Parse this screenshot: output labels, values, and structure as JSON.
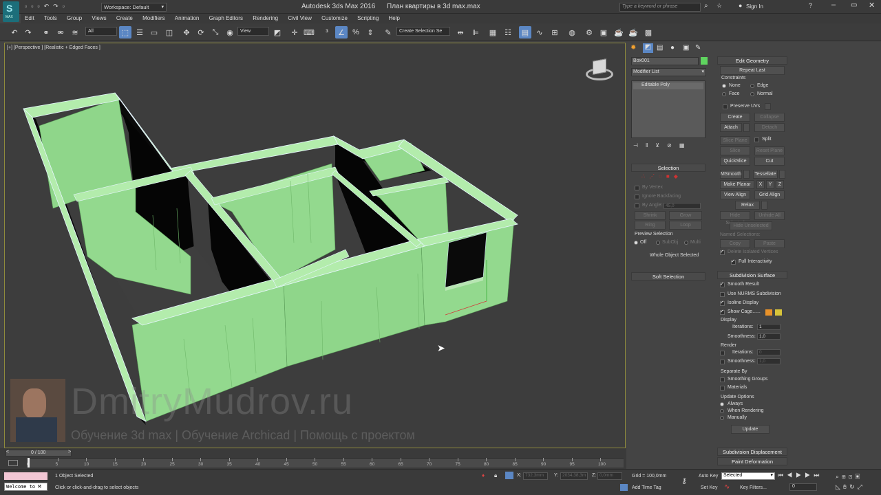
{
  "window": {
    "title": "Autodesk 3ds Max 2016",
    "document": "План квартиры в 3d max.max",
    "workspace": "Workspace: Default",
    "search_placeholder": "Type a keyword or phrase",
    "sign_in": "Sign In"
  },
  "menu": [
    "Edit",
    "Tools",
    "Group",
    "Views",
    "Create",
    "Modifiers",
    "Animation",
    "Graph Editors",
    "Rendering",
    "Civil View",
    "Customize",
    "Scripting",
    "Help"
  ],
  "toolbar": {
    "filter": "All",
    "ref_coord": "View",
    "selection_set": "Create Selection Se"
  },
  "viewport": {
    "label": "[+] [Perspective ] [Realistic + Edged Faces ]",
    "watermark": "DmitryMudrov.ru",
    "watermark_sub": "Обучение 3d max | Обучение Archicad | Помощь с проектом"
  },
  "command_panel": {
    "object_name": "Box001",
    "object_color": "#5fd45f",
    "modifier_list": "Modifier List",
    "stack_item": "Editable Poly",
    "selection": {
      "title": "Selection",
      "by_vertex": "By Vertex",
      "ignore_backfacing": "Ignore Backfacing",
      "by_angle": "By Angle:",
      "by_angle_value": "45,0",
      "shrink": "Shrink",
      "grow": "Grow",
      "ring": "Ring",
      "loop": "Loop",
      "preview_title": "Preview Selection",
      "off": "Off",
      "subobj": "SubObj",
      "multi": "Multi",
      "status": "Whole Object Selected"
    },
    "soft_selection": "Soft Selection"
  },
  "edit_geometry": {
    "title": "Edit Geometry",
    "repeat_last": "Repeat Last",
    "constraints": "Constraints",
    "none": "None",
    "edge": "Edge",
    "face": "Face",
    "normal": "Normal",
    "preserve_uvs": "Preserve UVs",
    "create": "Create",
    "collapse": "Collapse",
    "attach": "Attach",
    "detach": "Detach",
    "slice_plane": "Slice Plane",
    "split": "Split",
    "slice": "Slice",
    "reset_plane": "Reset Plane",
    "quickslice": "QuickSlice",
    "cut": "Cut",
    "msmooth": "MSmooth",
    "tessellate": "Tessellate",
    "make_planar": "Make Planar",
    "x": "X",
    "y": "Y",
    "z": "Z",
    "view_align": "View Align",
    "grid_align": "Grid Align",
    "relax": "Relax",
    "hide_selected": "Hide Selected",
    "unhide_all": "Unhide All",
    "hide_unselected": "Hide Unselected",
    "named_selections": "Named Selections:",
    "copy": "Copy",
    "paste": "Paste",
    "delete_isolated": "Delete Isolated Vertices",
    "full_interactivity": "Full Interactivity"
  },
  "subdivision": {
    "title": "Subdivision Surface",
    "smooth_result": "Smooth Result",
    "use_nurms": "Use NURMS Subdivision",
    "isoline": "Isoline Display",
    "show_cage": "Show Cage......",
    "cage_color1": "#e8922a",
    "cage_color2": "#d8c43a",
    "display": "Display",
    "iterations": "Iterations:",
    "iterations_value": "1",
    "smoothness": "Smoothness:",
    "smoothness_value": "1,0",
    "render": "Render",
    "r_iterations": "Iterations:",
    "r_iterations_value": "0",
    "r_smoothness": "Smoothness:",
    "r_smoothness_value": "1,0",
    "separate_by": "Separate By",
    "smoothing_groups": "Smoothing Groups",
    "materials": "Materials",
    "update_options": "Update Options",
    "always": "Always",
    "when_rendering": "When Rendering",
    "manually": "Manually",
    "update": "Update",
    "subdiv_displacement": "Subdivision Displacement",
    "paint_deformation": "Paint Deformation"
  },
  "timeline": {
    "frame": "0 / 100",
    "ticks": [
      "0",
      "5",
      "10",
      "15",
      "20",
      "25",
      "30",
      "35",
      "40",
      "45",
      "50",
      "55",
      "60",
      "65",
      "70",
      "75",
      "80",
      "85",
      "90",
      "95",
      "100"
    ]
  },
  "status": {
    "welcome": "Welcome to M",
    "selected": "1 Object Selected",
    "prompt": "Click or click-and-drag to select objects",
    "x_label": "X:",
    "x_value": "732,3mm",
    "y_label": "Y:",
    "y_value": "2034,38,3m",
    "z_label": "Z:",
    "z_value": "0,0mm",
    "grid": "Grid = 100,0mm",
    "add_time_tag": "Add Time Tag",
    "auto_key": "Auto Key",
    "set_key": "Set Key",
    "key_mode": "Selected",
    "key_filters": "Key Filters...",
    "current_frame": "0"
  }
}
